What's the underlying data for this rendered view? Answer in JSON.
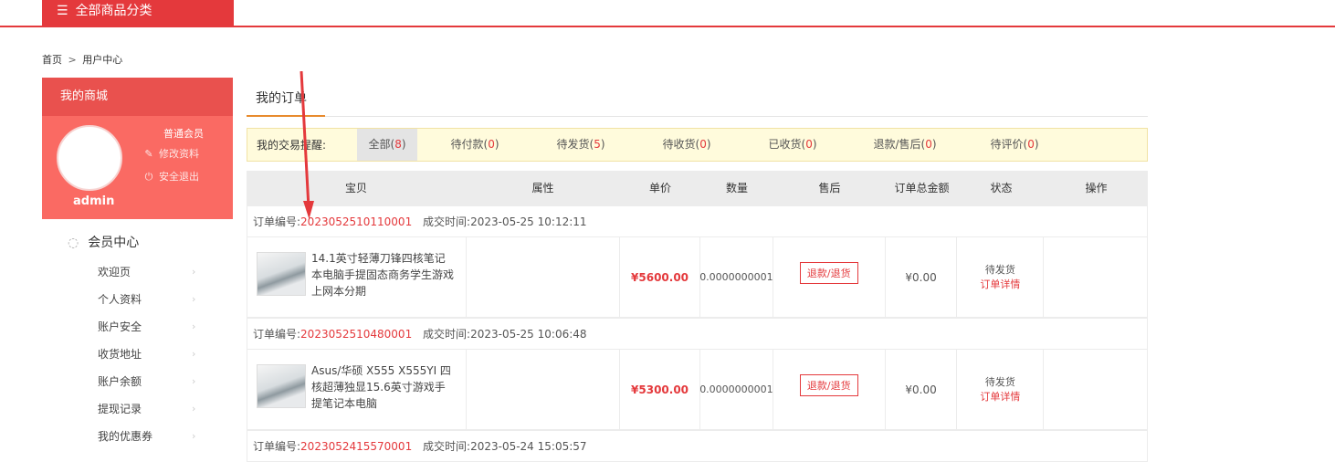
{
  "header": {
    "category_button": "全部商品分类"
  },
  "breadcrumb": {
    "home": "首页",
    "separator": ">",
    "current": "用户中心"
  },
  "sidebar": {
    "title": "我的商城",
    "member_level": "普通会员",
    "edit_profile": "修改资料",
    "logout": "安全退出",
    "username": "admin",
    "section_title": "会员中心",
    "items": [
      {
        "label": "欢迎页"
      },
      {
        "label": "个人资料"
      },
      {
        "label": "账户安全"
      },
      {
        "label": "收货地址"
      },
      {
        "label": "账户余额"
      },
      {
        "label": "提现记录"
      },
      {
        "label": "我的优惠券"
      }
    ]
  },
  "main": {
    "title": "我的订单",
    "status_label": "我的交易提醒:",
    "tabs": [
      {
        "label": "全部",
        "count": "8"
      },
      {
        "label": "待付款",
        "count": "0"
      },
      {
        "label": "待发货",
        "count": "5"
      },
      {
        "label": "待收货",
        "count": "0"
      },
      {
        "label": "已收货",
        "count": "0"
      },
      {
        "label": "退款/售后",
        "count": "0"
      },
      {
        "label": "待评价",
        "count": "0"
      }
    ],
    "columns": [
      "宝贝",
      "属性",
      "单价",
      "数量",
      "售后",
      "订单总金额",
      "状态",
      "操作"
    ],
    "order_no_label": "订单编号:",
    "deal_time_label": "成交时间:",
    "orders": [
      {
        "id": "2023052510110001",
        "time": "2023-05-25 10:12:11",
        "product": "14.1英寸轻薄刀锋四核笔记本电脑手提固态商务学生游戏上网本分期",
        "attr": "",
        "price": "¥5600.00",
        "qty": "0.0000000001",
        "after_sale": "退款/退货",
        "total": "¥0.00",
        "status": "待发货",
        "detail": "订单详情"
      },
      {
        "id": "2023052510480001",
        "time": "2023-05-25 10:06:48",
        "product": "Asus/华硕 X555 X555YI 四核超薄独显15.6英寸游戏手提笔记本电脑",
        "attr": "",
        "price": "¥5300.00",
        "qty": "0.0000000001",
        "after_sale": "退款/退货",
        "total": "¥0.00",
        "status": "待发货",
        "detail": "订单详情"
      },
      {
        "id": "2023052415570001",
        "time": "2023-05-24 15:05:57"
      }
    ]
  },
  "colors": {
    "brand_red": "#e4393c",
    "sidebar_head": "#e9514e",
    "sidebar_user": "#fa6a63",
    "tab_accent": "#e88b2e"
  }
}
